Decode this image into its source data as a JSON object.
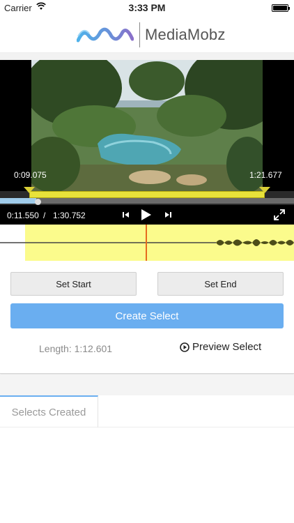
{
  "status_bar": {
    "carrier": "Carrier",
    "time": "3:33 PM",
    "wifi_icon": "wifi-icon",
    "battery_icon": "battery-icon"
  },
  "header": {
    "logo_text": "MediaMobz",
    "logo_icon": "wave-logo-icon"
  },
  "player": {
    "start_marker": "0:09.075",
    "end_marker": "1:21.677",
    "current_time": "0:11.550",
    "separator": "/",
    "duration": "1:30.752",
    "icons": [
      "previous-icon",
      "play-icon",
      "next-icon",
      "fullscreen-icon"
    ]
  },
  "editor": {
    "set_start_label": "Set Start",
    "set_end_label": "Set End",
    "create_label": "Create Select",
    "length_text": "Length: 1:12.601",
    "preview_label": "Preview Select"
  },
  "tabs": {
    "active": "Selects Created"
  },
  "colors": {
    "accent_blue": "#6aaef0",
    "selection_yellow": "#fbfb8c",
    "playhead_orange": "#e66a1e"
  }
}
